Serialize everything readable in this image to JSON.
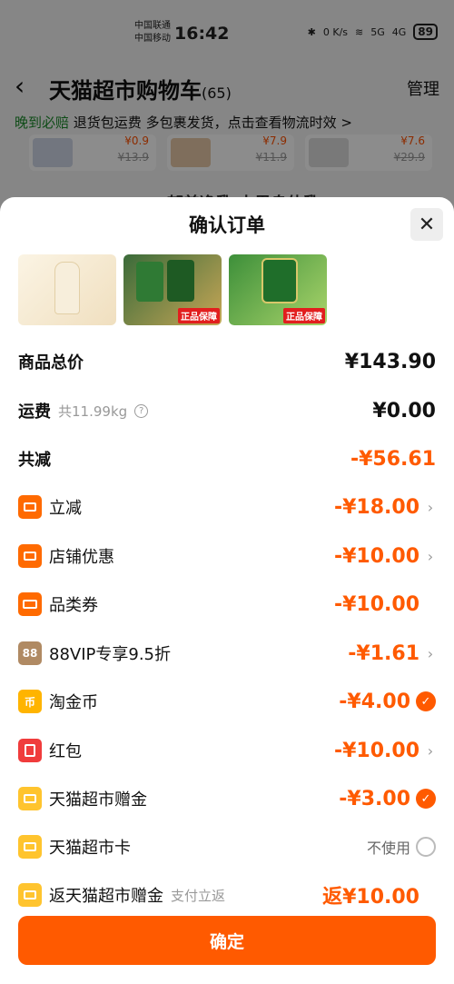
{
  "status_bar": {
    "carrier1": "中国联通",
    "carrier2": "中国移动",
    "time": "16:42",
    "net_speed": "0 K/s",
    "signal1": "5G",
    "signal2": "4G",
    "battery": "89"
  },
  "cart": {
    "title": "天猫超市购物车",
    "count": "(65)",
    "manage": "管理",
    "notice_highlight": "晚到必赔",
    "notice_text": "退货包运费 多包裹发货，点击查看物流时效 >",
    "items": [
      {
        "price": "¥0.9",
        "orig": "¥13.9"
      },
      {
        "price": "¥7.9",
        "orig": "¥11.9"
      },
      {
        "price": "¥7.6",
        "orig": "¥29.9"
      }
    ],
    "behind_text": "郁美净乳 本果息体乳"
  },
  "sheet": {
    "title": "确认订单",
    "products": [
      {
        "badge": ""
      },
      {
        "badge": "正品保障"
      },
      {
        "badge": "正品保障"
      }
    ],
    "rows": {
      "total": {
        "label": "商品总价",
        "value": "¥143.90"
      },
      "shipping": {
        "label": "运费",
        "sub": "共11.99kg",
        "value": "¥0.00"
      },
      "reduce": {
        "label": "共减",
        "value": "-¥56.61"
      },
      "instant": {
        "label": "立减",
        "value": "-¥18.00"
      },
      "shop": {
        "label": "店铺优惠",
        "value": "-¥10.00"
      },
      "category": {
        "label": "品类券",
        "value": "-¥10.00"
      },
      "vip": {
        "label": "88VIP专享9.5折",
        "value": "-¥1.61",
        "icon_text": "88"
      },
      "coins": {
        "label": "淘金币",
        "value": "-¥4.00",
        "icon_text": "币"
      },
      "redpacket": {
        "label": "红包",
        "value": "-¥10.00"
      },
      "giftmoney": {
        "label": "天猫超市赠金",
        "value": "-¥3.00"
      },
      "card": {
        "label": "天猫超市卡",
        "value": "不使用"
      },
      "rebate": {
        "label": "返天猫超市赠金",
        "sub": "支付立返",
        "value": "返¥10.00"
      }
    },
    "confirm_label": "确定"
  },
  "colors": {
    "accent": "#ff5a00",
    "green": "#1a8a2a"
  }
}
